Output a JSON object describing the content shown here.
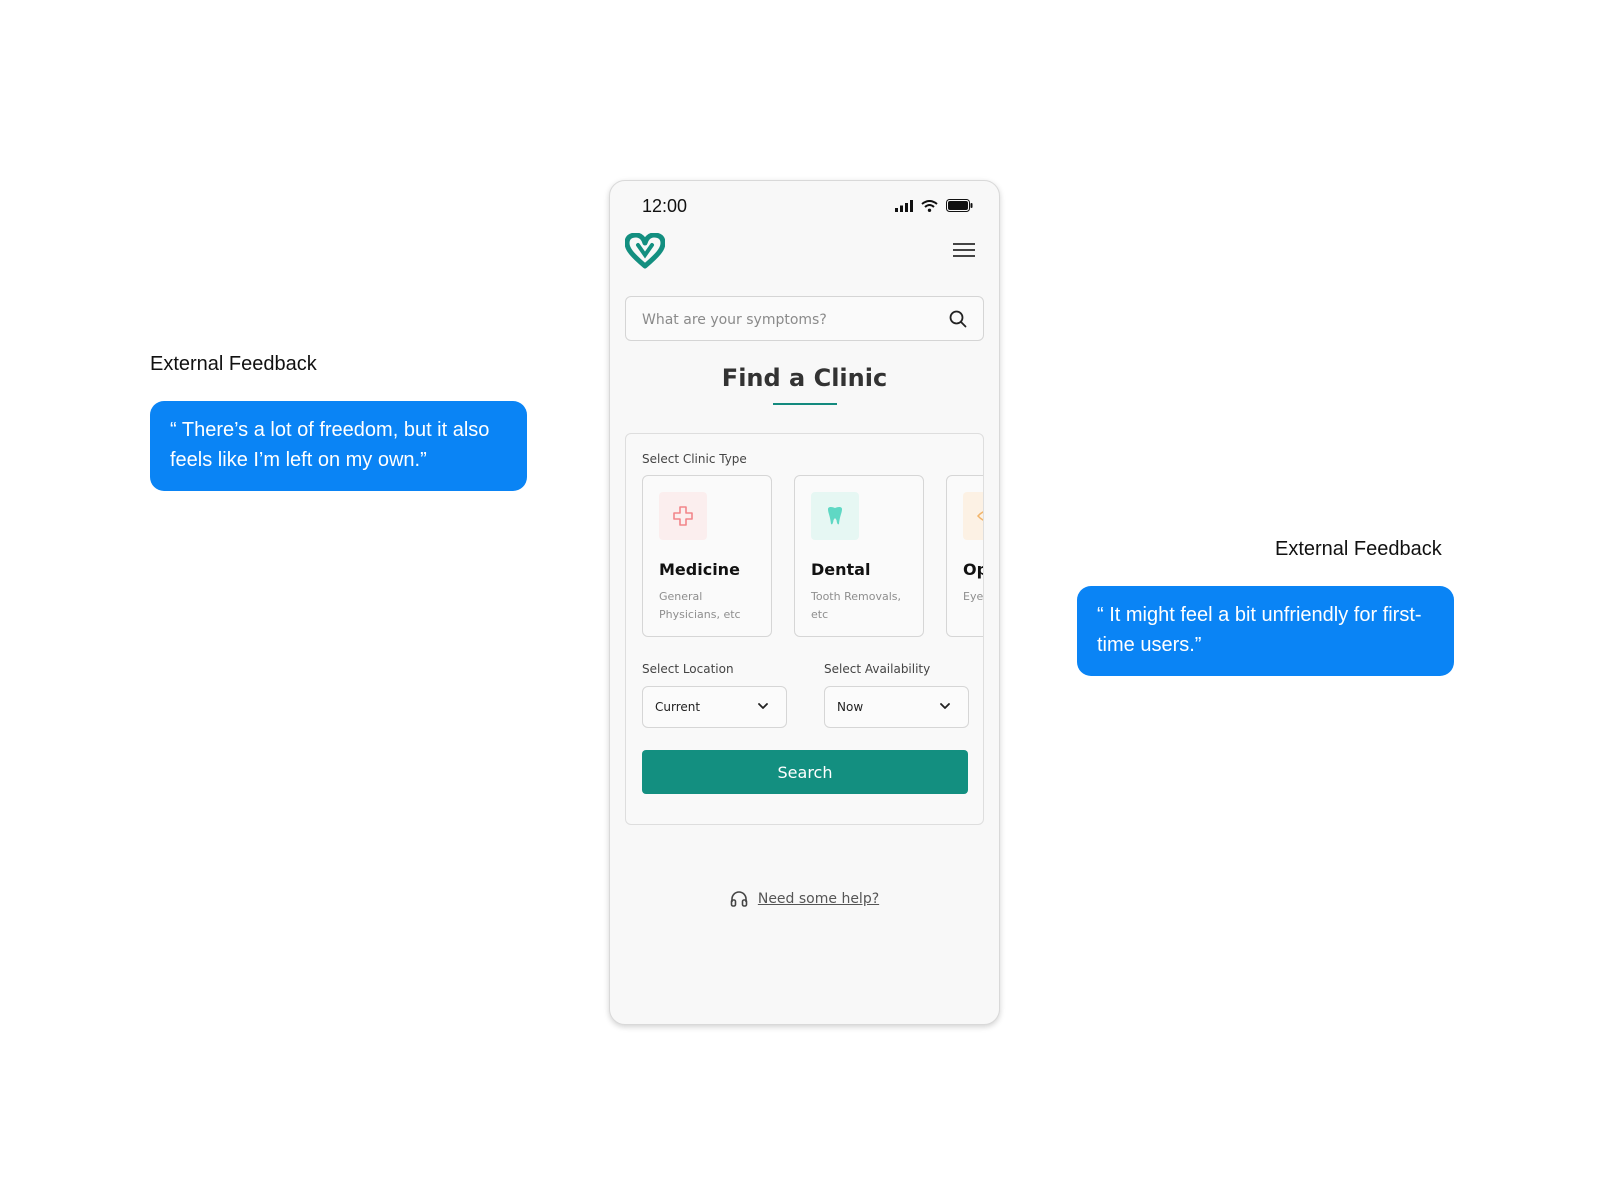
{
  "feedback": [
    {
      "label": "External Feedback",
      "quote": "“ There’s a lot of freedom, but it also feels like I’m left on my own.”"
    },
    {
      "label": "External Feedback",
      "quote": "“ It might feel a bit unfriendly for first-time users.”"
    }
  ],
  "phone": {
    "status_time": "12:00",
    "search": {
      "placeholder": "What are your symptoms?"
    },
    "page_title": "Find a Clinic",
    "clinic_type_label": "Select Clinic Type",
    "clinic_types": [
      {
        "name": "Medicine",
        "desc": "General Physicians, etc",
        "icon": "medical-cross-icon",
        "accent": "#f2858a"
      },
      {
        "name": "Dental",
        "desc": "Tooth Removals, etc",
        "icon": "tooth-icon",
        "accent": "#5fd8c4"
      },
      {
        "name": "Op",
        "desc": "Eye Pres",
        "icon": "eye-icon",
        "accent": "#f2b56b"
      }
    ],
    "location": {
      "label": "Select Location",
      "value": "Current"
    },
    "availability": {
      "label": "Select Availability",
      "value": "Now"
    },
    "search_button": "Search",
    "help_link": "Need some help?"
  },
  "colors": {
    "brand_teal": "#138f80",
    "bubble_blue": "#0a84f5"
  }
}
